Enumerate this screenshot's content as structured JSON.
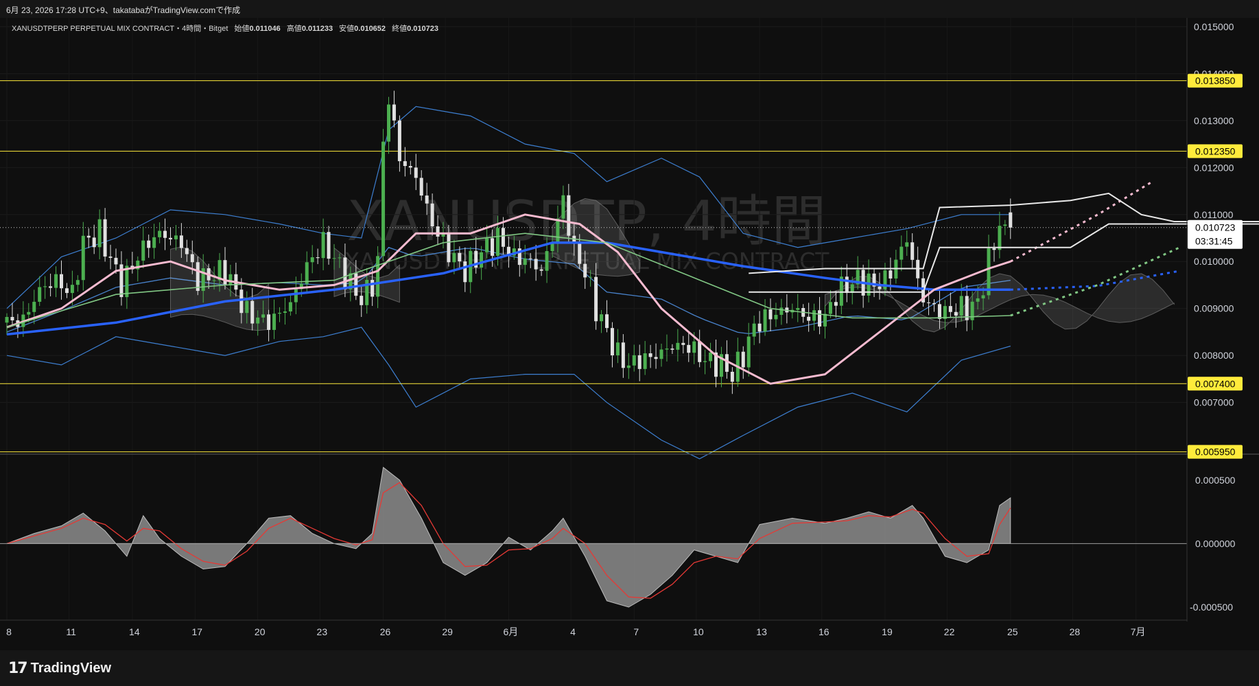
{
  "header": {
    "title": "6月 23, 2026 17:28 UTC+9、takatabaがTradingView.comで作成"
  },
  "legend": {
    "symbol": "XANUSDTPERP PERPETUAL MIX CONTRACT・4時間・Bitget",
    "open_label": "始値",
    "open": "0.011046",
    "high_label": "高値",
    "high": "0.011233",
    "low_label": "安値",
    "low": "0.010652",
    "close_label": "終値",
    "close": "0.010723"
  },
  "watermark": {
    "main": "XANUSDTP, 4時間",
    "sub": "XANUSDTPERP PERPETUAL MIX CONTRACT"
  },
  "footer": {
    "brand": "TradingView"
  },
  "colors": {
    "background": "#0f0f0f",
    "up": "#4caf50",
    "down": "#e0e0e0",
    "ma_blue": "#2962ff",
    "ma_pink": "#f8bbd0",
    "bb": "#3d7fd1",
    "level": "#ffeb3b",
    "macd_signal": "#e53935",
    "histogram": "#8c8c8c"
  },
  "chart_data": [
    {
      "type": "candlestick",
      "title": "XANUSDTPERP PERPETUAL MIX CONTRACT・4時間・Bitget",
      "x_ticks": [
        "8",
        "11",
        "14",
        "17",
        "20",
        "23",
        "26",
        "29",
        "6月",
        "4",
        "7",
        "10",
        "13",
        "16",
        "19",
        "22",
        "25",
        "28",
        "7月"
      ],
      "y_ticks": [
        "0.015000",
        "0.014000",
        "0.013000",
        "0.012000",
        "0.011000",
        "0.010000",
        "0.009000",
        "0.008000",
        "0.007000"
      ],
      "ylim": [
        0.0059,
        0.0151
      ],
      "last_price": "0.010723",
      "countdown": "03:31:45",
      "levels": [
        {
          "value": 0.01385,
          "label": "0.013850"
        },
        {
          "value": 0.01235,
          "label": "0.012350"
        },
        {
          "value": 0.0074,
          "label": "0.007400"
        },
        {
          "value": 0.00595,
          "label": "0.005950"
        }
      ],
      "close_path": [
        [
          0,
          0.0087
        ],
        [
          3,
          0.00875
        ],
        [
          6,
          0.0094
        ],
        [
          9,
          0.0096
        ],
        [
          12,
          0.0093
        ],
        [
          14,
          0.0104
        ],
        [
          17,
          0.0106
        ],
        [
          21,
          0.0095
        ],
        [
          25,
          0.0103
        ],
        [
          28,
          0.0106
        ],
        [
          32,
          0.0104
        ],
        [
          35,
          0.0096
        ],
        [
          40,
          0.0098
        ],
        [
          44,
          0.0089
        ],
        [
          48,
          0.0087
        ],
        [
          52,
          0.0091
        ],
        [
          55,
          0.0099
        ],
        [
          58,
          0.0104
        ],
        [
          61,
          0.0099
        ],
        [
          63,
          0.0095
        ],
        [
          65,
          0.0092
        ],
        [
          67,
          0.0095
        ],
        [
          68,
          0.01
        ],
        [
          69,
          0.0125
        ],
        [
          70,
          0.0135
        ],
        [
          72,
          0.0122
        ],
        [
          75,
          0.0118
        ],
        [
          78,
          0.0108
        ],
        [
          81,
          0.0102
        ],
        [
          84,
          0.0098
        ],
        [
          87,
          0.0102
        ],
        [
          90,
          0.0105
        ],
        [
          93,
          0.0101
        ],
        [
          96,
          0.01
        ],
        [
          98,
          0.0098
        ],
        [
          100,
          0.0105
        ],
        [
          102,
          0.0113
        ],
        [
          104,
          0.0102
        ],
        [
          106,
          0.0098
        ],
        [
          108,
          0.009
        ],
        [
          110,
          0.0085
        ],
        [
          112,
          0.008
        ],
        [
          114,
          0.0078
        ],
        [
          116,
          0.0079
        ],
        [
          119,
          0.008
        ],
        [
          122,
          0.0082
        ],
        [
          125,
          0.0082
        ],
        [
          128,
          0.0079
        ],
        [
          131,
          0.0078
        ],
        [
          133,
          0.0076
        ],
        [
          135,
          0.008
        ],
        [
          137,
          0.0086
        ],
        [
          139,
          0.0088
        ],
        [
          141,
          0.0089
        ],
        [
          144,
          0.009
        ],
        [
          147,
          0.0088
        ],
        [
          150,
          0.0088
        ],
        [
          152,
          0.0093
        ],
        [
          154,
          0.0095
        ],
        [
          156,
          0.0096
        ],
        [
          159,
          0.0095
        ],
        [
          161,
          0.0096
        ],
        [
          163,
          0.01
        ],
        [
          165,
          0.0105
        ],
        [
          166,
          0.01
        ],
        [
          168,
          0.0092
        ],
        [
          170,
          0.009
        ],
        [
          172,
          0.0089
        ],
        [
          174,
          0.009
        ],
        [
          176,
          0.009
        ],
        [
          178,
          0.0091
        ],
        [
          180,
          0.01
        ],
        [
          182,
          0.0108
        ],
        [
          183,
          0.0106
        ],
        [
          184,
          0.01072
        ]
      ],
      "moving_averages": [
        {
          "color": "#2962ff",
          "values": [
            [
              0,
              0.00845
            ],
            [
              20,
              0.0087
            ],
            [
              40,
              0.00915
            ],
            [
              60,
              0.0094
            ],
            [
              80,
              0.00975
            ],
            [
              100,
              0.0104
            ],
            [
              110,
              0.0104
            ],
            [
              120,
              0.0102
            ],
            [
              135,
              0.0099
            ],
            [
              150,
              0.00965
            ],
            [
              160,
              0.0095
            ],
            [
              170,
              0.0094
            ],
            [
              184,
              0.0094
            ]
          ],
          "projection": [
            [
              184,
              0.0094
            ],
            [
              200,
              0.00948
            ],
            [
              215,
              0.0098
            ]
          ]
        },
        {
          "color": "#f8bbd0",
          "values": [
            [
              0,
              0.0086
            ],
            [
              10,
              0.009
            ],
            [
              20,
              0.0098
            ],
            [
              30,
              0.01
            ],
            [
              40,
              0.0096
            ],
            [
              50,
              0.0094
            ],
            [
              60,
              0.0095
            ],
            [
              68,
              0.0098
            ],
            [
              75,
              0.0106
            ],
            [
              85,
              0.0106
            ],
            [
              95,
              0.011
            ],
            [
              105,
              0.0108
            ],
            [
              112,
              0.0102
            ],
            [
              120,
              0.009
            ],
            [
              130,
              0.008
            ],
            [
              140,
              0.0074
            ],
            [
              150,
              0.0076
            ],
            [
              160,
              0.0085
            ],
            [
              170,
              0.0094
            ],
            [
              180,
              0.00985
            ],
            [
              184,
              0.01
            ]
          ],
          "projection": [
            [
              184,
              0.01
            ],
            [
              200,
              0.011
            ],
            [
              210,
              0.0117
            ]
          ]
        },
        {
          "color": "#81c784",
          "values": [
            [
              0,
              0.0086
            ],
            [
              20,
              0.0093
            ],
            [
              40,
              0.0095
            ],
            [
              60,
              0.0096
            ],
            [
              80,
              0.0104
            ],
            [
              95,
              0.0106
            ],
            [
              110,
              0.0104
            ],
            [
              125,
              0.0097
            ],
            [
              140,
              0.009
            ],
            [
              155,
              0.0088
            ],
            [
              170,
              0.0088
            ],
            [
              184,
              0.00885
            ]
          ],
          "projection": [
            [
              184,
              0.00885
            ],
            [
              200,
              0.0095
            ],
            [
              215,
              0.0103
            ]
          ]
        }
      ],
      "bollinger": {
        "upper": [
          [
            0,
            0.009
          ],
          [
            10,
            0.0101
          ],
          [
            20,
            0.0105
          ],
          [
            30,
            0.0111
          ],
          [
            40,
            0.011
          ],
          [
            50,
            0.0108
          ],
          [
            58,
            0.0106
          ],
          [
            65,
            0.0105
          ],
          [
            70,
            0.0128
          ],
          [
            75,
            0.0133
          ],
          [
            85,
            0.0131
          ],
          [
            95,
            0.0125
          ],
          [
            104,
            0.0123
          ],
          [
            110,
            0.0117
          ],
          [
            120,
            0.0122
          ],
          [
            127,
            0.0118
          ],
          [
            135,
            0.0106
          ],
          [
            145,
            0.0103
          ],
          [
            155,
            0.0105
          ],
          [
            165,
            0.0107
          ],
          [
            175,
            0.011
          ],
          [
            184,
            0.011
          ]
        ],
        "lower": [
          [
            0,
            0.008
          ],
          [
            10,
            0.0078
          ],
          [
            20,
            0.0084
          ],
          [
            30,
            0.0082
          ],
          [
            40,
            0.008
          ],
          [
            50,
            0.0083
          ],
          [
            58,
            0.0084
          ],
          [
            65,
            0.0086
          ],
          [
            70,
            0.0078
          ],
          [
            75,
            0.0069
          ],
          [
            85,
            0.0075
          ],
          [
            95,
            0.0076
          ],
          [
            104,
            0.0076
          ],
          [
            110,
            0.007
          ],
          [
            120,
            0.0062
          ],
          [
            127,
            0.0058
          ],
          [
            135,
            0.0063
          ],
          [
            145,
            0.0069
          ],
          [
            155,
            0.0072
          ],
          [
            165,
            0.0068
          ],
          [
            175,
            0.0079
          ],
          [
            184,
            0.0082
          ]
        ]
      }
    },
    {
      "type": "area",
      "title": "MACD",
      "y_ticks": [
        "0.000500",
        "0.000000",
        "-0.000500"
      ],
      "ylim": [
        -0.00057,
        0.00065
      ],
      "histogram": [
        [
          0,
          0.0
        ],
        [
          5,
          8e-05
        ],
        [
          10,
          0.00014
        ],
        [
          14,
          0.00024
        ],
        [
          18,
          0.0001
        ],
        [
          22,
          -0.0001
        ],
        [
          25,
          0.00022
        ],
        [
          28,
          4e-05
        ],
        [
          32,
          -0.0001
        ],
        [
          36,
          -0.0002
        ],
        [
          40,
          -0.00018
        ],
        [
          44,
          0.0
        ],
        [
          48,
          0.0002
        ],
        [
          52,
          0.00022
        ],
        [
          56,
          8e-05
        ],
        [
          60,
          0.0
        ],
        [
          64,
          -4e-05
        ],
        [
          67,
          8e-05
        ],
        [
          69,
          0.0006
        ],
        [
          72,
          0.0005
        ],
        [
          76,
          0.0002
        ],
        [
          80,
          -0.00015
        ],
        [
          84,
          -0.00025
        ],
        [
          88,
          -0.00015
        ],
        [
          92,
          5e-05
        ],
        [
          96,
          -5e-05
        ],
        [
          100,
          0.0001
        ],
        [
          102,
          0.0002
        ],
        [
          106,
          -0.0001
        ],
        [
          110,
          -0.00045
        ],
        [
          114,
          -0.0005
        ],
        [
          118,
          -0.0004
        ],
        [
          122,
          -0.00025
        ],
        [
          126,
          -5e-05
        ],
        [
          130,
          -0.0001
        ],
        [
          134,
          -0.00015
        ],
        [
          138,
          0.00015
        ],
        [
          144,
          0.0002
        ],
        [
          150,
          0.00016
        ],
        [
          154,
          0.0002
        ],
        [
          158,
          0.00025
        ],
        [
          162,
          0.0002
        ],
        [
          166,
          0.0003
        ],
        [
          168,
          0.0002
        ],
        [
          172,
          -0.0001
        ],
        [
          176,
          -0.00015
        ],
        [
          180,
          -5e-05
        ],
        [
          182,
          0.0003
        ],
        [
          184,
          0.00036
        ]
      ],
      "signal": [
        [
          0,
          0.0
        ],
        [
          5,
          6e-05
        ],
        [
          10,
          0.00012
        ],
        [
          14,
          0.0002
        ],
        [
          18,
          0.00015
        ],
        [
          22,
          2e-05
        ],
        [
          25,
          0.00012
        ],
        [
          28,
          0.0001
        ],
        [
          32,
          -4e-05
        ],
        [
          36,
          -0.00014
        ],
        [
          40,
          -0.00017
        ],
        [
          44,
          -6e-05
        ],
        [
          48,
          0.00012
        ],
        [
          52,
          0.0002
        ],
        [
          56,
          0.00012
        ],
        [
          60,
          4e-05
        ],
        [
          64,
          -1e-05
        ],
        [
          67,
          3e-05
        ],
        [
          69,
          0.0004
        ],
        [
          72,
          0.00048
        ],
        [
          76,
          0.0003
        ],
        [
          80,
          0.0
        ],
        [
          84,
          -0.00018
        ],
        [
          88,
          -0.00017
        ],
        [
          92,
          -5e-05
        ],
        [
          96,
          -4e-05
        ],
        [
          100,
          4e-05
        ],
        [
          102,
          0.00012
        ],
        [
          106,
          0.0
        ],
        [
          110,
          -0.00025
        ],
        [
          114,
          -0.00042
        ],
        [
          118,
          -0.00043
        ],
        [
          122,
          -0.00032
        ],
        [
          126,
          -0.00015
        ],
        [
          130,
          -0.0001
        ],
        [
          134,
          -0.00012
        ],
        [
          138,
          4e-05
        ],
        [
          144,
          0.00016
        ],
        [
          150,
          0.00017
        ],
        [
          154,
          0.00018
        ],
        [
          158,
          0.00022
        ],
        [
          162,
          0.00021
        ],
        [
          166,
          0.00027
        ],
        [
          168,
          0.00024
        ],
        [
          172,
          4e-05
        ],
        [
          176,
          -0.0001
        ],
        [
          180,
          -8e-05
        ],
        [
          182,
          0.00015
        ],
        [
          184,
          0.00028
        ]
      ]
    }
  ]
}
